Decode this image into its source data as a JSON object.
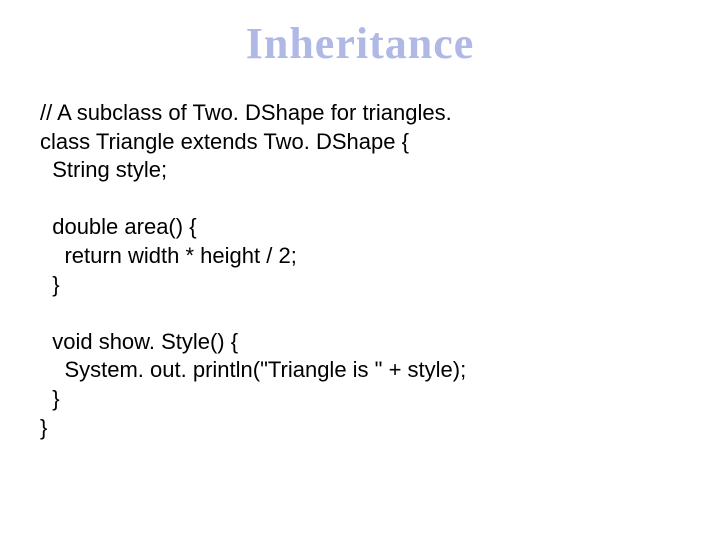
{
  "title": "Inheritance",
  "code": "// A subclass of Two. DShape for triangles.\nclass Triangle extends Two. DShape {\n  String style;\n\n  double area() {\n    return width * height / 2;\n  }\n\n  void show. Style() {\n    System. out. println(\"Triangle is \" + style);\n  }\n}"
}
